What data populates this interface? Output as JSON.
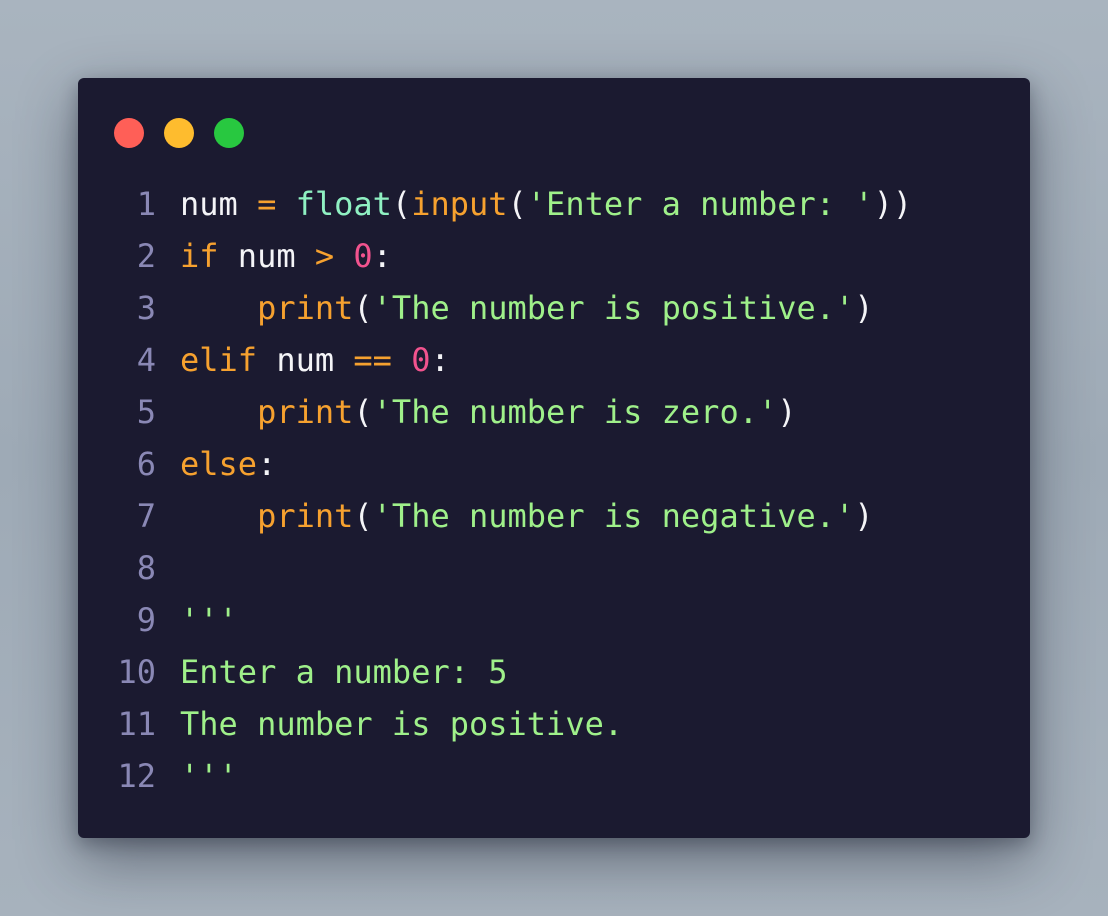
{
  "window": {
    "traffic_lights": [
      {
        "name": "close",
        "color": "#ff5f57"
      },
      {
        "name": "minimize",
        "color": "#febc2e"
      },
      {
        "name": "maximize",
        "color": "#28c840"
      }
    ]
  },
  "code": {
    "lines": [
      {
        "number": "1",
        "tokens": [
          {
            "text": "num ",
            "type": "plain"
          },
          {
            "text": "=",
            "type": "op"
          },
          {
            "text": " ",
            "type": "plain"
          },
          {
            "text": "float",
            "type": "builtin"
          },
          {
            "text": "(",
            "type": "punc"
          },
          {
            "text": "input",
            "type": "fn"
          },
          {
            "text": "(",
            "type": "punc"
          },
          {
            "text": "'Enter a number: '",
            "type": "str"
          },
          {
            "text": "))",
            "type": "punc"
          }
        ]
      },
      {
        "number": "2",
        "tokens": [
          {
            "text": "if",
            "type": "kw"
          },
          {
            "text": " num ",
            "type": "plain"
          },
          {
            "text": ">",
            "type": "op"
          },
          {
            "text": " ",
            "type": "plain"
          },
          {
            "text": "0",
            "type": "num"
          },
          {
            "text": ":",
            "type": "punc"
          }
        ]
      },
      {
        "number": "3",
        "tokens": [
          {
            "text": "    ",
            "type": "plain"
          },
          {
            "text": "print",
            "type": "fn"
          },
          {
            "text": "(",
            "type": "punc"
          },
          {
            "text": "'The number is positive.'",
            "type": "str"
          },
          {
            "text": ")",
            "type": "punc"
          }
        ]
      },
      {
        "number": "4",
        "tokens": [
          {
            "text": "elif",
            "type": "kw"
          },
          {
            "text": " num ",
            "type": "plain"
          },
          {
            "text": "==",
            "type": "op"
          },
          {
            "text": " ",
            "type": "plain"
          },
          {
            "text": "0",
            "type": "num"
          },
          {
            "text": ":",
            "type": "punc"
          }
        ]
      },
      {
        "number": "5",
        "tokens": [
          {
            "text": "    ",
            "type": "plain"
          },
          {
            "text": "print",
            "type": "fn"
          },
          {
            "text": "(",
            "type": "punc"
          },
          {
            "text": "'The number is zero.'",
            "type": "str"
          },
          {
            "text": ")",
            "type": "punc"
          }
        ]
      },
      {
        "number": "6",
        "tokens": [
          {
            "text": "else",
            "type": "kw"
          },
          {
            "text": ":",
            "type": "punc"
          }
        ]
      },
      {
        "number": "7",
        "tokens": [
          {
            "text": "    ",
            "type": "plain"
          },
          {
            "text": "print",
            "type": "fn"
          },
          {
            "text": "(",
            "type": "punc"
          },
          {
            "text": "'The number is negative.'",
            "type": "str"
          },
          {
            "text": ")",
            "type": "punc"
          }
        ]
      },
      {
        "number": "8",
        "tokens": []
      },
      {
        "number": "9",
        "tokens": [
          {
            "text": "'''",
            "type": "out"
          }
        ]
      },
      {
        "number": "10",
        "tokens": [
          {
            "text": "Enter a number: 5",
            "type": "out"
          }
        ]
      },
      {
        "number": "11",
        "tokens": [
          {
            "text": "The number is positive.",
            "type": "out"
          }
        ]
      },
      {
        "number": "12",
        "tokens": [
          {
            "text": "'''",
            "type": "out"
          }
        ]
      }
    ]
  }
}
